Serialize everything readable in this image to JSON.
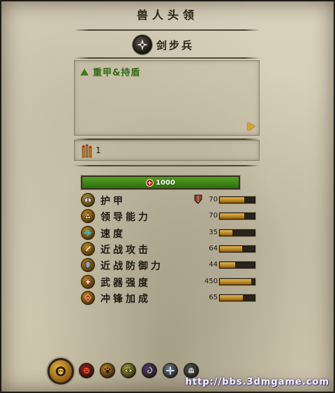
{
  "window": {
    "title": "兽人头领"
  },
  "unit": {
    "name": "剑步兵",
    "icon": "star-emblem-icon"
  },
  "abilities": [
    {
      "label": "重甲&持盾",
      "icon": "green-triangle-up-icon",
      "color": "#2f6a13"
    }
  ],
  "ammo": {
    "icon": "arrows-quiver-icon",
    "value": "1"
  },
  "health": {
    "value": "1000",
    "icon": "red-plus-icon",
    "color": "#3f8617"
  },
  "stats": [
    {
      "label": "护甲",
      "value": "70",
      "fill": 0.7,
      "icon": "armor-helmet-icon",
      "icon_bg": "#b39a43",
      "shield": "shield-icon"
    },
    {
      "label": "领导能力",
      "value": "70",
      "fill": 0.7,
      "icon": "leadership-icon",
      "icon_bg": "#c78a22"
    },
    {
      "label": "速度",
      "value": "35",
      "fill": 0.35,
      "icon": "speed-arrow-icon",
      "icon_bg": "#c78a22"
    },
    {
      "label": "近战攻击",
      "value": "64",
      "fill": 0.64,
      "icon": "melee-attack-icon",
      "icon_bg": "#c78a22"
    },
    {
      "label": "近战防御力",
      "value": "44",
      "fill": 0.44,
      "icon": "melee-defence-icon",
      "icon_bg": "#c78a22"
    },
    {
      "label": "武器强度",
      "value": "450",
      "fill": 0.9,
      "icon": "weapon-strength-icon",
      "icon_bg": "#c78a22"
    },
    {
      "label": "冲锋加成",
      "value": "65",
      "fill": 0.65,
      "icon": "charge-bonus-icon",
      "icon_bg": "#c78a22"
    }
  ],
  "bottom_abilities": [
    {
      "icon": "orc-boss-ability-icon",
      "bg": "#c78a22"
    },
    {
      "icon": "rage-face-icon",
      "bg": "#9a1f1a"
    },
    {
      "icon": "paw-icon",
      "bg": "#c78a22"
    },
    {
      "icon": "eye-icon",
      "bg": "#b1a43a"
    },
    {
      "icon": "arcane-swirl-icon",
      "bg": "#5c3a76"
    },
    {
      "icon": "frost-cross-icon",
      "bg": "#6c7f8f"
    },
    {
      "icon": "beast-head-icon",
      "bg": "#4f5751"
    }
  ],
  "watermark": "http://bbs.3dmgame.com"
}
